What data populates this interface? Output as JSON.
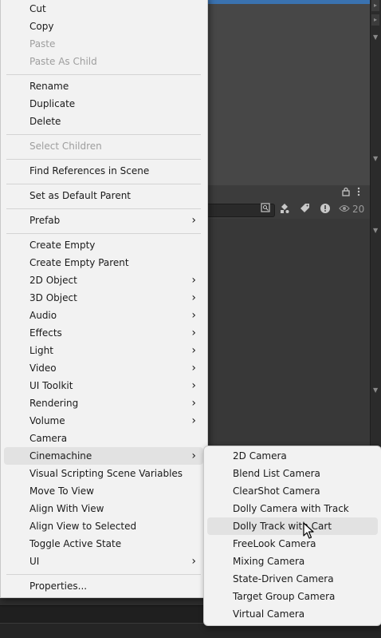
{
  "menu": {
    "items": [
      {
        "label": "Cut",
        "disabled": false,
        "submenu": false
      },
      {
        "label": "Copy",
        "disabled": false,
        "submenu": false
      },
      {
        "label": "Paste",
        "disabled": true,
        "submenu": false
      },
      {
        "label": "Paste As Child",
        "disabled": true,
        "submenu": false
      },
      {
        "label": "Rename",
        "disabled": false,
        "submenu": false
      },
      {
        "label": "Duplicate",
        "disabled": false,
        "submenu": false
      },
      {
        "label": "Delete",
        "disabled": false,
        "submenu": false
      },
      {
        "label": "Select Children",
        "disabled": true,
        "submenu": false
      },
      {
        "label": "Find References in Scene",
        "disabled": false,
        "submenu": false
      },
      {
        "label": "Set as Default Parent",
        "disabled": false,
        "submenu": false
      },
      {
        "label": "Prefab",
        "disabled": false,
        "submenu": true
      },
      {
        "label": "Create Empty",
        "disabled": false,
        "submenu": false
      },
      {
        "label": "Create Empty Parent",
        "disabled": false,
        "submenu": false
      },
      {
        "label": "2D Object",
        "disabled": false,
        "submenu": true
      },
      {
        "label": "3D Object",
        "disabled": false,
        "submenu": true
      },
      {
        "label": "Audio",
        "disabled": false,
        "submenu": true
      },
      {
        "label": "Effects",
        "disabled": false,
        "submenu": true
      },
      {
        "label": "Light",
        "disabled": false,
        "submenu": true
      },
      {
        "label": "Video",
        "disabled": false,
        "submenu": true
      },
      {
        "label": "UI Toolkit",
        "disabled": false,
        "submenu": true
      },
      {
        "label": "Rendering",
        "disabled": false,
        "submenu": true
      },
      {
        "label": "Volume",
        "disabled": false,
        "submenu": true
      },
      {
        "label": "Camera",
        "disabled": false,
        "submenu": false
      },
      {
        "label": "Cinemachine",
        "disabled": false,
        "submenu": true,
        "highlighted": true
      },
      {
        "label": "Visual Scripting Scene Variables",
        "disabled": false,
        "submenu": false
      },
      {
        "label": "Move To View",
        "disabled": false,
        "submenu": false
      },
      {
        "label": "Align With View",
        "disabled": false,
        "submenu": false
      },
      {
        "label": "Align View to Selected",
        "disabled": false,
        "submenu": false
      },
      {
        "label": "Toggle Active State",
        "disabled": false,
        "submenu": false
      },
      {
        "label": "UI",
        "disabled": false,
        "submenu": true
      },
      {
        "label": "Properties...",
        "disabled": false,
        "submenu": false
      }
    ]
  },
  "submenu": {
    "items": [
      {
        "label": "2D Camera"
      },
      {
        "label": "Blend List Camera"
      },
      {
        "label": "ClearShot Camera"
      },
      {
        "label": "Dolly Camera with Track"
      },
      {
        "label": "Dolly Track with Cart",
        "highlighted": true
      },
      {
        "label": "FreeLook Camera"
      },
      {
        "label": "Mixing Camera"
      },
      {
        "label": "State-Driven Camera"
      },
      {
        "label": "Target Group Camera"
      },
      {
        "label": "Virtual Camera"
      }
    ]
  },
  "toolbar": {
    "visible_count": "20"
  },
  "icons": {
    "submenu_arrow": "chevron-right-icon",
    "lock": "lock-icon",
    "more": "kebab-menu-icon",
    "scene_visibility": "eye-icon"
  },
  "colors": {
    "menu_bg": "#f2f2f2",
    "highlight_bg": "#e2e2e2",
    "disabled_text": "#9e9e9e",
    "editor_accent": "#3a72b0"
  }
}
